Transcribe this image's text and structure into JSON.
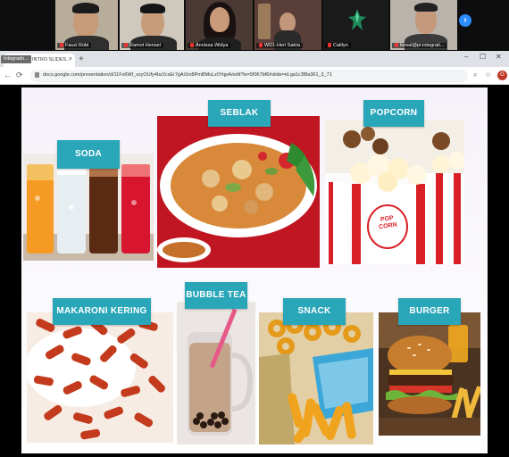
{
  "meeting": {
    "participants": [
      {
        "name": "Fauzi Robi"
      },
      {
        "name": "Ramot Hensel"
      },
      {
        "name": "Annissa Widya"
      },
      {
        "name": "WD1-Heri Satria"
      },
      {
        "name": "Caitlyn"
      },
      {
        "name": "farsal@pi-integrati..."
      }
    ],
    "next_arrow": "›"
  },
  "browser": {
    "tab_title": "INTRO SLIDES...",
    "tab_tooltip": "Intogrado...",
    "new_tab": "+",
    "url": "docs.google.com/presentation/d/11Fx6Wf_xzyOUfy4bz2csEr7gAi1to8PmBMuLz0YqpA/edit?ts=5f067bf6#slide=id.ga1c3f8a361_3_71",
    "window_controls": [
      "–",
      "☐",
      "✕"
    ],
    "profile_initial": "G"
  },
  "slide": {
    "labels": {
      "soda": "SODA",
      "seblak": "SEBLAK",
      "popcorn": "POPCORN",
      "makaroni": "MAKARONI KERING",
      "bubble_tea": "BUBBLE TEA",
      "snack": "SNACK",
      "burger": "BURGER"
    },
    "popcorn_box_text": "POP CORN"
  },
  "colors": {
    "label_bg": "#2aa6b9",
    "slide_bg": "#ffffff",
    "zoom_blue": "#2d8cff"
  }
}
